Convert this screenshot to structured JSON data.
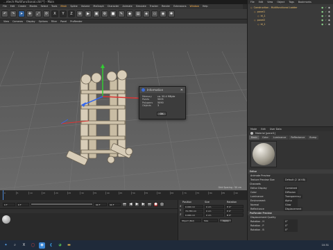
{
  "window": {
    "title": "...ntech Multifunctional.c4d *] - Main"
  },
  "menu": [
    "File",
    "Edit",
    "Create",
    "Modes",
    "Select",
    "Tools",
    "Mesh",
    "Spline",
    "Volume",
    "MoGraph",
    "Character",
    "Animate",
    "Simulate",
    "Tracker",
    "Render",
    "Extensions",
    "Window",
    "Help"
  ],
  "menu_highlight": [
    "Mesh",
    "Window"
  ],
  "toolbar": {
    "axis_x": "X",
    "axis_y": "Y",
    "axis_z": "Z"
  },
  "viewport_menu": [
    "View",
    "Cameras",
    "Display",
    "Options",
    "Filter",
    "Panel",
    "ProRender"
  ],
  "viewport": {
    "grid_spacing": "Grid Spacing : 50 cm"
  },
  "info_dialog": {
    "title": "Information",
    "rows": [
      {
        "k": "Memory",
        "v": "ca. 50.4 MByte"
      },
      {
        "k": "Points",
        "v": "5005"
      },
      {
        "k": "Polygons",
        "v": "5090"
      },
      {
        "k": "Objects",
        "v": "3"
      }
    ],
    "ok_label": "OK"
  },
  "object_manager": {
    "menu": [
      "File",
      "Edit",
      "View",
      "Object",
      "Tags",
      "Bookmarks"
    ],
    "objects": [
      {
        "name": "Construction - Multifunctional Ladder",
        "indent": 0
      },
      {
        "name": "panel1",
        "indent": 1
      },
      {
        "name": "ld_1",
        "indent": 2
      },
      {
        "name": "panel2",
        "indent": 1
      },
      {
        "name": "ld_1",
        "indent": 2
      }
    ]
  },
  "attribute_manager": {
    "menu": [
      "Mode",
      "Edit",
      "User Data"
    ],
    "material_label": "Material [panel1]",
    "tabs": [
      "Basic",
      "Color",
      "Luminance",
      "Reflectance",
      "Bump"
    ],
    "section": "Editor",
    "fields": [
      {
        "k": "Animate Preview",
        "v": ""
      },
      {
        "k": "Texture Preview Size",
        "v": "Default (2 16 KB)"
      }
    ],
    "subsection": "Channels",
    "channels": [
      {
        "k": "Editor Display",
        "v": "Combined"
      },
      {
        "k": "Color",
        "v": "Diffusion"
      },
      {
        "k": "Luminance",
        "v": "Transparency"
      },
      {
        "k": "Environment",
        "v": "Alpha"
      },
      {
        "k": "Normal",
        "v": "Glow"
      },
      {
        "k": "Reflectance",
        "v": "Displacement"
      }
    ],
    "section2": "ProRender Preview",
    "fields2": [
      {
        "k": "Displacement Quality",
        "v": ""
      }
    ],
    "rotation": [
      {
        "k": "Rotation . H",
        "v": "0°"
      },
      {
        "k": "Rotation . P",
        "v": "0°"
      },
      {
        "k": "Rotation . B",
        "v": "0°"
      }
    ]
  },
  "timeline": {
    "ticks": [
      "0",
      "5",
      "10",
      "15",
      "20",
      "25",
      "30",
      "35",
      "40",
      "45",
      "50",
      "55",
      "60",
      "65",
      "70",
      "75",
      "80",
      "85",
      "90"
    ],
    "start": "0 F",
    "end": "90 F",
    "current": "0 F"
  },
  "coordinates": {
    "headers": [
      "Position",
      "Size",
      "Rotation"
    ],
    "rows": [
      {
        "axis": "X",
        "pos": "0.000 cm",
        "size": "0 cm",
        "rot": "H 0°"
      },
      {
        "axis": "Y",
        "pos": "70.783 cm",
        "size": "0 cm",
        "rot": "P 0°"
      },
      {
        "axis": "Z",
        "pos": "0.000 cm",
        "size": "0 cm",
        "rot": "B 0°"
      }
    ],
    "mode": "Object (Rel)",
    "size_mode": "Size",
    "apply_label": "Apply"
  },
  "taskbar": {
    "time": "10:31"
  },
  "colors": {
    "accent": "#ffb24a",
    "selected_blue": "#2e5f9a",
    "viewport": "#5e5e5e"
  }
}
